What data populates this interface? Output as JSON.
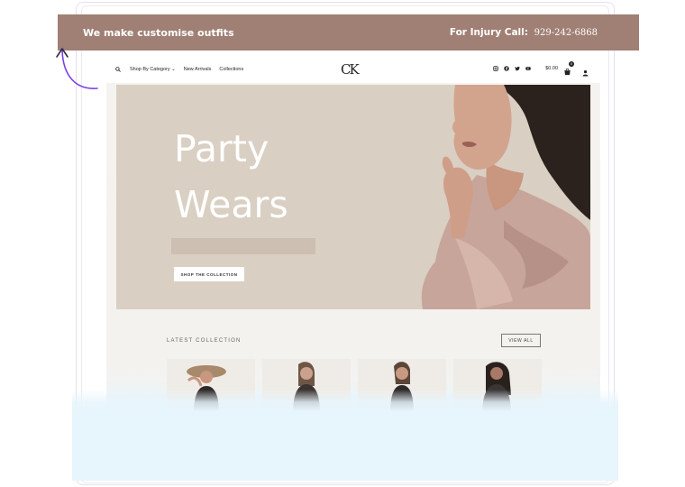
{
  "announcement": {
    "left_text": "We make customise outfits",
    "right_label": "For Injury Call:",
    "right_phone": "929-242-6868"
  },
  "header": {
    "logo": "CK",
    "nav": [
      "Shop By Category",
      "New Arrivals",
      "Collections"
    ],
    "cart_amount": "$0.00",
    "cart_count": "0",
    "social_icons": [
      "instagram-icon",
      "facebook-icon",
      "twitter-icon",
      "youtube-icon"
    ]
  },
  "hero": {
    "title_line1": "Party",
    "title_line2": "Wears",
    "cta_label": "SHOP THE COLLECTION"
  },
  "collection": {
    "heading": "LATEST COLLECTION",
    "view_all_label": "VIEW ALL"
  },
  "colors": {
    "announcement_bg": "#a07f74",
    "hero_bg": "#d9cfc3",
    "accent_arrow": "#7b3fe4"
  }
}
